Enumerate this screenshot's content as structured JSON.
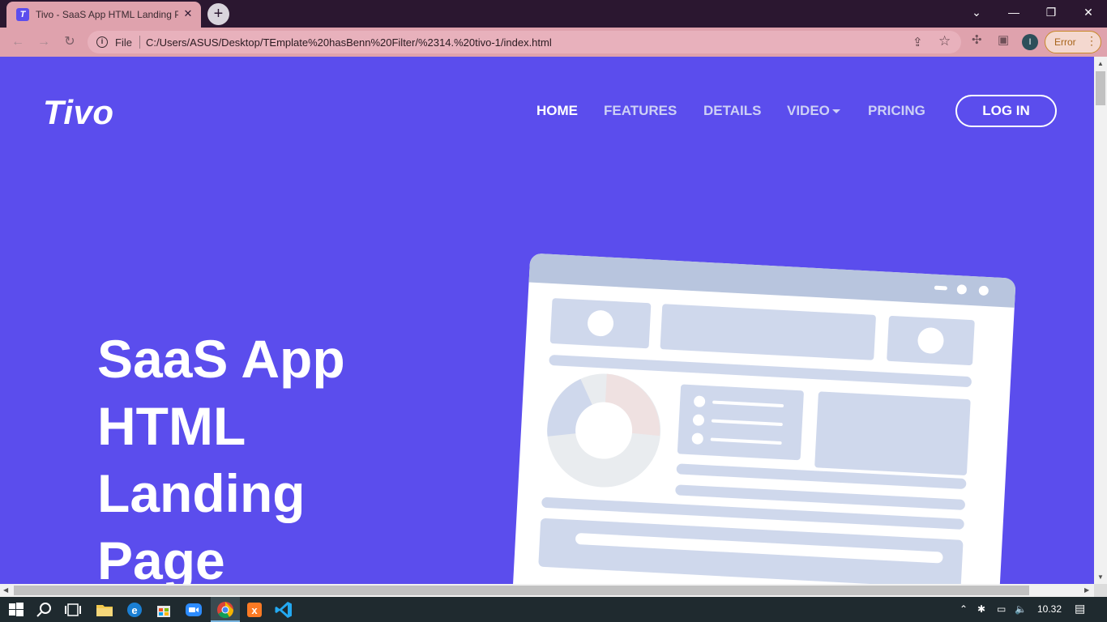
{
  "browser": {
    "tab_title": "Tivo - SaaS App HTML Landing P",
    "tab_favicon_letter": "T",
    "url_scheme": "File",
    "url": "C:/Users/ASUS/Desktop/TEmplate%20hasBenn%20Filter/%2314.%20tivo-1/index.html",
    "profile_initial": "I",
    "error_label": "Error"
  },
  "page": {
    "logo": "Tivo",
    "nav": [
      {
        "label": "HOME"
      },
      {
        "label": "FEATURES"
      },
      {
        "label": "DETAILS"
      },
      {
        "label": "VIDEO"
      },
      {
        "label": "PRICING"
      }
    ],
    "login_label": "LOG IN",
    "hero_title": "SaaS App HTML Landing Page"
  },
  "taskbar": {
    "time": "10.32"
  },
  "colors": {
    "brand_purple": "#5b4ded",
    "chrome_tab": "#dfa2ad",
    "titlebar": "#2b1730",
    "illustration_card": "#cfd8ec"
  }
}
